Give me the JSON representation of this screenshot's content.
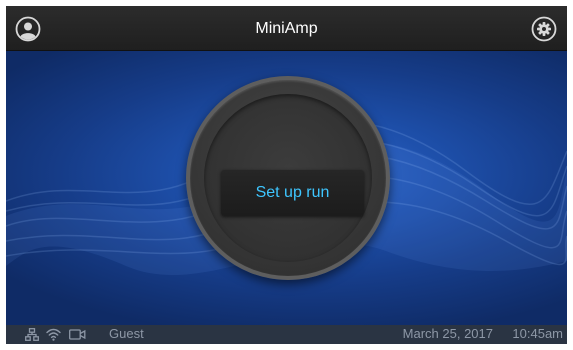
{
  "header": {
    "title": "MiniAmp",
    "user_icon": "user-profile-icon",
    "settings_icon": "gear-icon"
  },
  "main": {
    "setup_button_label": "Set up run"
  },
  "status_bar": {
    "icons": [
      "network-icon",
      "wifi-icon",
      "camera-icon"
    ],
    "user": "Guest",
    "date": "March 25, 2017",
    "time": "10:45am"
  },
  "colors": {
    "accent_text": "#3ec6ff",
    "header_bg": "#252525",
    "status_bg": "#2a3443",
    "background_blue": "#1d4ea8"
  }
}
